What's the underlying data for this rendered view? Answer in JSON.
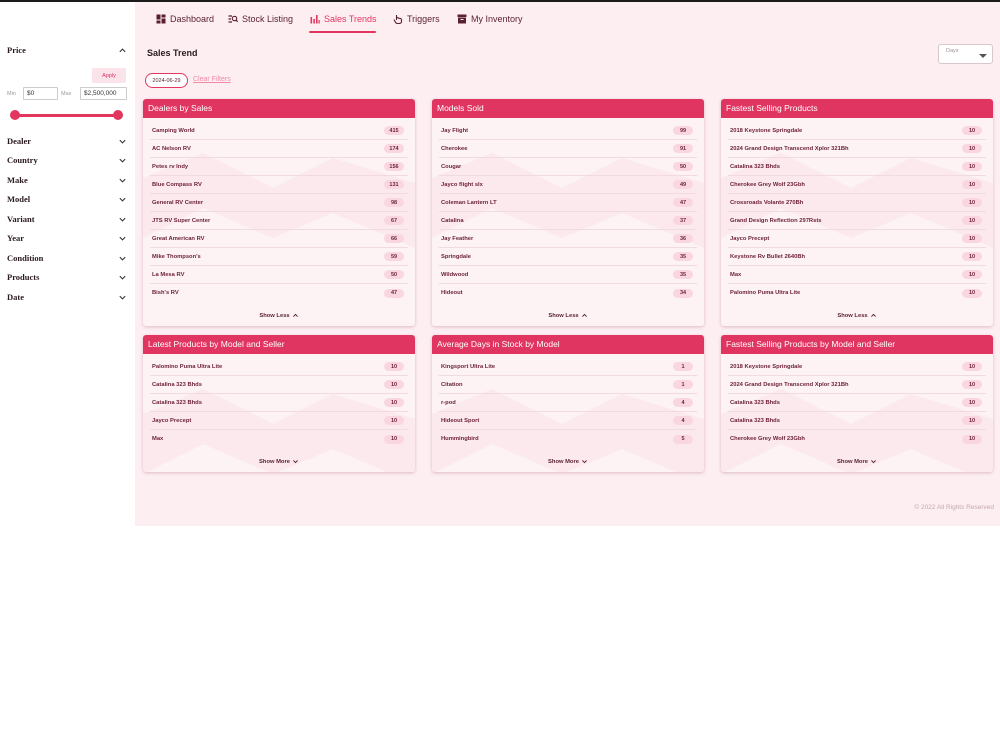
{
  "sidebar": {
    "price": {
      "label": "Price",
      "apply": "Apply",
      "min_label": "Min",
      "min_value": "$0",
      "max_label": "Max",
      "max_value": "$2,500,000"
    },
    "filters": [
      "Dealer",
      "Country",
      "Make",
      "Model",
      "Variant",
      "Year",
      "Condition",
      "Products",
      "Date"
    ]
  },
  "nav": {
    "items": [
      {
        "label": "Dashboard",
        "icon": "dashboard-icon"
      },
      {
        "label": "Stock Listing",
        "icon": "stock-listing-icon"
      },
      {
        "label": "Sales Trends",
        "icon": "bar-chart-icon",
        "active": true
      },
      {
        "label": "Triggers",
        "icon": "pointer-icon"
      },
      {
        "label": "My Inventory",
        "icon": "inventory-icon"
      }
    ]
  },
  "page": {
    "title": "Sales Trend",
    "days_placeholder": "Days",
    "date_chip": "2024-06-29",
    "clear_filters": "Clear Filters"
  },
  "cards": [
    {
      "title": "Dealers by Sales",
      "toggle": "Show Less",
      "rows": [
        {
          "name": "Camping World",
          "value": "415"
        },
        {
          "name": "AC Nelson RV",
          "value": "174"
        },
        {
          "name": "Petes rv Indy",
          "value": "156"
        },
        {
          "name": "Blue Compass RV",
          "value": "131"
        },
        {
          "name": "General RV Center",
          "value": "98"
        },
        {
          "name": "JTS RV Super Center",
          "value": "67"
        },
        {
          "name": "Great American RV",
          "value": "66"
        },
        {
          "name": "Mike Thompson's",
          "value": "59"
        },
        {
          "name": "La Mesa RV",
          "value": "50"
        },
        {
          "name": "Bish's RV",
          "value": "47"
        }
      ]
    },
    {
      "title": "Models Sold",
      "toggle": "Show Less",
      "rows": [
        {
          "name": "Jay Flight",
          "value": "99"
        },
        {
          "name": "Cherokee",
          "value": "91"
        },
        {
          "name": "Cougar",
          "value": "50"
        },
        {
          "name": "Jayco flight slx",
          "value": "49"
        },
        {
          "name": "Coleman Lantern LT",
          "value": "47"
        },
        {
          "name": "Catalina",
          "value": "37"
        },
        {
          "name": "Jay Feather",
          "value": "36"
        },
        {
          "name": "Springdale",
          "value": "35"
        },
        {
          "name": "Wildwood",
          "value": "35"
        },
        {
          "name": "Hideout",
          "value": "34"
        }
      ]
    },
    {
      "title": "Fastest Selling Products",
      "toggle": "Show Less",
      "rows": [
        {
          "name": "2018 Keystone Springdale",
          "value": "10"
        },
        {
          "name": "2024 Grand Design Transcend Xplor 321Bh",
          "value": "10"
        },
        {
          "name": "Catalina 323 Bhds",
          "value": "10"
        },
        {
          "name": "Cherokee Grey Wolf 23Gbh",
          "value": "10"
        },
        {
          "name": "Crossroads Volante 270Bh",
          "value": "10"
        },
        {
          "name": "Grand Design Reflection 297Rsts",
          "value": "10"
        },
        {
          "name": "Jayco Precept",
          "value": "10"
        },
        {
          "name": "Keystone Rv Bullet 2640Bh",
          "value": "10"
        },
        {
          "name": "Max",
          "value": "10"
        },
        {
          "name": "Palomino Puma Ultra Lite",
          "value": "10"
        }
      ]
    },
    {
      "title": "Latest Products by Model and Seller",
      "toggle": "Show More",
      "rows": [
        {
          "name": "Palomino Puma Ultra Lite",
          "value": "10"
        },
        {
          "name": "Catalina 323 Bhds",
          "value": "10"
        },
        {
          "name": "Catalina 323 Bhds",
          "value": "10"
        },
        {
          "name": "Jayco Precept",
          "value": "10"
        },
        {
          "name": "Max",
          "value": "10"
        }
      ]
    },
    {
      "title": "Average Days in Stock by Model",
      "toggle": "Show More",
      "rows": [
        {
          "name": "Kingsport Ultra Lite",
          "value": "1"
        },
        {
          "name": "Citation",
          "value": "1"
        },
        {
          "name": "r-pod",
          "value": "4"
        },
        {
          "name": "Hideout Sport",
          "value": "4"
        },
        {
          "name": "Hummingbird",
          "value": "5"
        }
      ]
    },
    {
      "title": "Fastest Selling Products by Model and Seller",
      "toggle": "Show More",
      "rows": [
        {
          "name": "2018 Keystone Springdale",
          "value": "10"
        },
        {
          "name": "2024 Grand Design Transcend Xplor 321Bh",
          "value": "10"
        },
        {
          "name": "Catalina 323 Bhds",
          "value": "10"
        },
        {
          "name": "Catalina 323 Bhds",
          "value": "10"
        },
        {
          "name": "Cherokee Grey Wolf 23Gbh",
          "value": "10"
        }
      ]
    }
  ],
  "footer": "© 2022 All Rights Reserved",
  "colors": {
    "accent": "#df3560",
    "background": "#fdeef2"
  }
}
